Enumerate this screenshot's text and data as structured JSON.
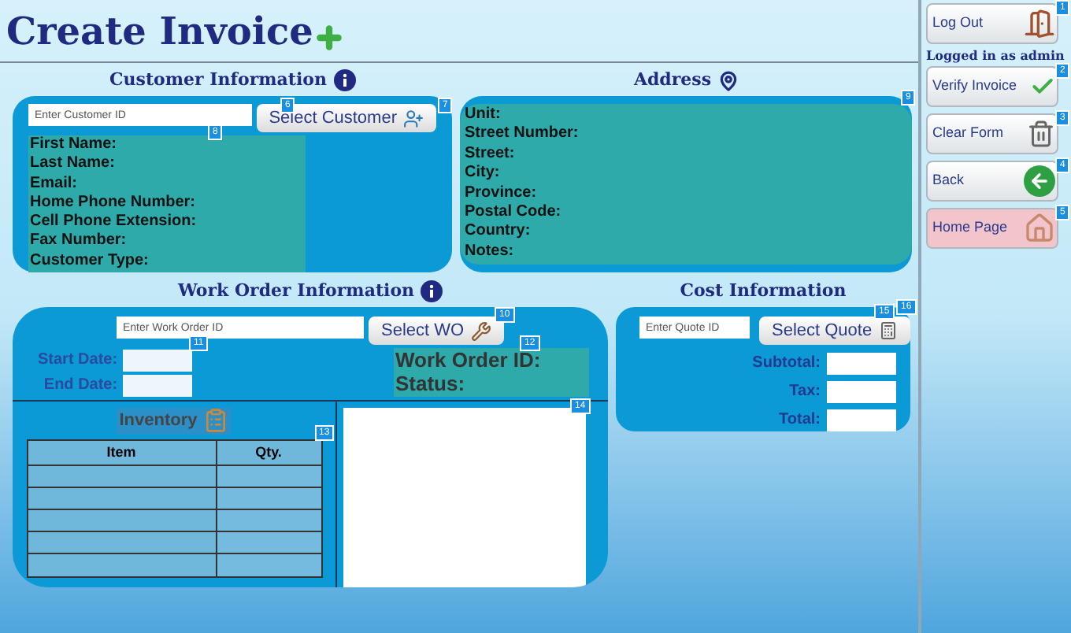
{
  "title": "Create Invoice",
  "customer": {
    "heading": "Customer Information",
    "id_field": {
      "placeholder": "Enter Customer ID",
      "badge": "6"
    },
    "button": {
      "label": "Select Customer",
      "badge": "7"
    },
    "details_badge": "8",
    "fields": [
      "First Name:",
      "Last Name:",
      "Email:",
      "Home Phone Number:",
      "Cell Phone Extension:",
      "Fax Number:",
      "Customer Type:"
    ]
  },
  "address": {
    "heading": "Address",
    "badge": "9",
    "fields": [
      "Unit:",
      "Street Number:",
      "Street:",
      "City:",
      "Province:",
      "Postal Code:",
      "Country:",
      "Notes:"
    ]
  },
  "work_order": {
    "heading": "Work Order Information",
    "id_field": {
      "placeholder": "Enter Work Order ID"
    },
    "button": {
      "label": "Select WO",
      "badge": "10"
    },
    "dates": [
      {
        "label": "Start Date:"
      },
      {
        "label": "End Date:"
      }
    ],
    "dates_badge": "11",
    "info": [
      "Work Order ID:",
      "Status:"
    ],
    "info_badge": "12",
    "inventory": {
      "heading": "Inventory",
      "badge": "13",
      "columns": [
        "Item",
        "Qty."
      ]
    },
    "notes_badge": "14"
  },
  "cost": {
    "heading": "Cost Information",
    "id_field": {
      "placeholder": "Enter Quote ID"
    },
    "button": {
      "label": "Select Quote",
      "badge": "15"
    },
    "panel_badge": "16",
    "fields": [
      {
        "label": "Subtotal:"
      },
      {
        "label": "Tax:"
      },
      {
        "label": "Total:"
      }
    ]
  },
  "sidebar": {
    "status": "Logged in as admin",
    "buttons": [
      {
        "label": "Log Out",
        "kind": "logout",
        "badge": "1"
      },
      {
        "label": "Verify Invoice",
        "kind": "verify",
        "badge": "2"
      },
      {
        "label": "Clear Form",
        "kind": "clear",
        "badge": "3"
      },
      {
        "label": "Back",
        "kind": "back",
        "badge": "4"
      },
      {
        "label": "Home Page",
        "kind": "home",
        "badge": "5"
      }
    ]
  }
}
